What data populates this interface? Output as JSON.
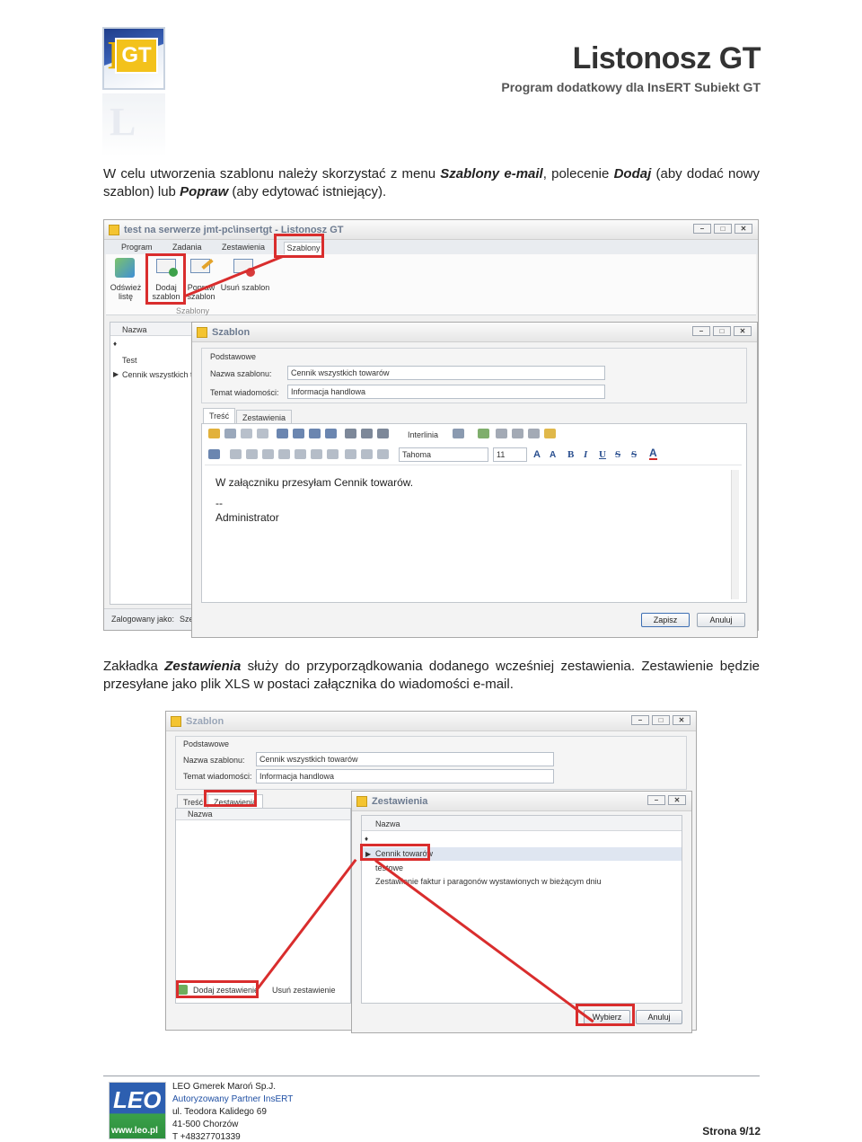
{
  "header": {
    "title": "Listonosz GT",
    "subtitle": "Program dodatkowy dla InsERT Subiekt GT",
    "logo_text": "GT"
  },
  "paragraph1": {
    "t1": "W celu utworzenia szablonu należy skorzystać z menu ",
    "b1": "Szablony e-mail",
    "t2": ", polecenie ",
    "b2": "Dodaj",
    "t3": " (aby dodać nowy szablon) lub ",
    "b3": "Popraw",
    "t4": " (aby edytować istniejący)."
  },
  "paragraph2": {
    "t1": "Zakładka ",
    "b1": "Zestawienia",
    "t2": " służy do przyporządkowania dodanego wcześniej zestawienia. Zestawienie będzie przesyłane jako plik XLS w postaci załącznika do wiadomości e-mail."
  },
  "screenshot1": {
    "app_title": "test na serwerze jmt-pc\\insertgt - Listonosz GT",
    "menu": [
      "Program",
      "Zadania",
      "Zestawienia",
      "Szablony"
    ],
    "ribbon": [
      {
        "label1": "Odśwież",
        "label2": "listę",
        "icon": "refresh-icon"
      },
      {
        "label1": "Dodaj",
        "label2": "szablon",
        "icon": "mail-add-icon"
      },
      {
        "label1": "Popraw",
        "label2": "szablon",
        "icon": "mail-edit-icon"
      },
      {
        "label1": "Usuń szablon",
        "label2": "",
        "icon": "mail-delete-icon"
      }
    ],
    "ribbon_group": "Szablony",
    "list_header": "Nazwa",
    "list_rows": [
      "Test",
      "Cennik wszystkich to"
    ],
    "status_left": "Zalogowany jako:",
    "status_right": "Sze",
    "dialog": {
      "title": "Szablon",
      "group": "Podstawowe",
      "name_label": "Nazwa szablonu:",
      "name_value": "Cennik wszystkich towarów",
      "subject_label": "Temat wiadomości:",
      "subject_value": "Informacja handlowa",
      "tabs": [
        "Treść",
        "Zestawienia"
      ],
      "interline": "Interlinia",
      "font": "Tahoma",
      "font_size": "11",
      "body_line1": "W załączniku przesyłam Cennik towarów.",
      "body_line2": "--",
      "body_line3": "Administrator",
      "save": "Zapisz",
      "cancel": "Anuluj"
    }
  },
  "screenshot2": {
    "dialog_title": "Szablon",
    "group": "Podstawowe",
    "name_label": "Nazwa szablonu:",
    "name_value": "Cennik wszystkich towarów",
    "subject_label": "Temat wiadomości:",
    "subject_value": "Informacja handlowa",
    "tabs": [
      "Treść",
      "Zestawienia"
    ],
    "list_header": "Nazwa",
    "add_button": "Dodaj zestawienie",
    "remove_button": "Usuń zestawienie",
    "picker": {
      "title": "Zestawienia",
      "header": "Nazwa",
      "rows": [
        "Cennik towarów",
        "testowe",
        "Zestawienie faktur i paragonów wystawionych w bieżącym dniu"
      ],
      "select": "Wybierz",
      "cancel": "Anuluj"
    }
  },
  "footer": {
    "company": "LEO Gmerek Maroń Sp.J.",
    "partner": "Autoryzowany Partner InsERT",
    "street": "ul. Teodora Kalidego 69",
    "city": "41-500 Chorzów",
    "phone": "T +48327701339",
    "logo_word": "LEO",
    "logo_url": "www.leo.pl",
    "page": "Strona 9/12"
  }
}
